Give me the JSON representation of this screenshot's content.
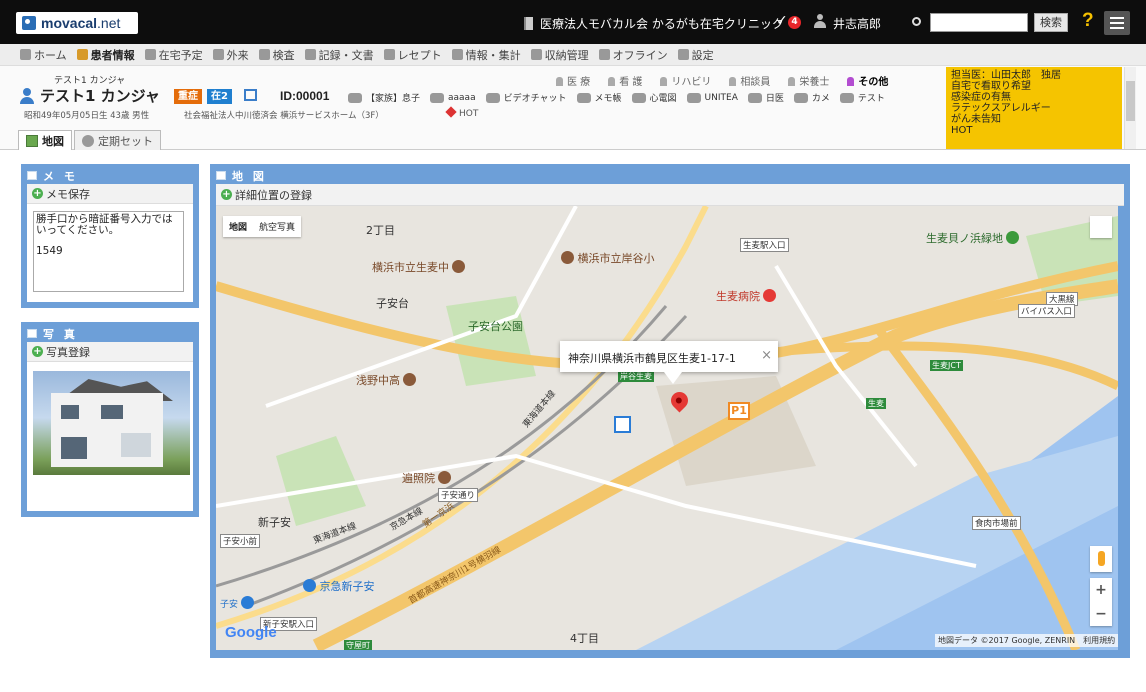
{
  "topbar": {
    "logo_text": "movacal",
    "logo_suffix": ".net",
    "facility": "医療法人モバカル会 かるがも在宅クリニック",
    "notification_count": "4",
    "user_name": "井志高郎",
    "search_placeholder": "",
    "search_button": "検索",
    "help": "?"
  },
  "nav": {
    "items": [
      {
        "label": "ホーム",
        "icon": "home-icon"
      },
      {
        "label": "患者情報",
        "icon": "patient-icon",
        "active": true
      },
      {
        "label": "在宅予定",
        "icon": "clock-icon"
      },
      {
        "label": "外来",
        "icon": "building-icon"
      },
      {
        "label": "検査",
        "icon": "chart-icon"
      },
      {
        "label": "記録・文書",
        "icon": "document-icon"
      },
      {
        "label": "レセプト",
        "icon": "receipt-icon"
      },
      {
        "label": "情報・集計",
        "icon": "database-icon"
      },
      {
        "label": "収納管理",
        "icon": "wallet-icon"
      },
      {
        "label": "オフライン",
        "icon": "offline-icon"
      },
      {
        "label": "設定",
        "icon": "gear-icon"
      }
    ]
  },
  "patient": {
    "kana": "テスト1 カンジャ",
    "name": "テスト1 カンジャ",
    "tag_severity": "重症",
    "tag_home": "在2",
    "id": "ID:00001",
    "birth": "昭和49年05月05日生 43歳 男性",
    "facility": "社会福祉法人中川徳済会 横浜サービスホーム（3F）",
    "hot": "HOT",
    "links": [
      "【家族】息子",
      "aaaaa",
      "ビデオチャット",
      "メモ帳",
      "心電図",
      "UNITEA",
      "日医",
      "カメ",
      "テスト"
    ],
    "roles": [
      {
        "label": "医 療",
        "active": false
      },
      {
        "label": "看 護",
        "active": false
      },
      {
        "label": "リハビリ",
        "active": false
      },
      {
        "label": "相談員",
        "active": false
      },
      {
        "label": "栄養士",
        "active": false
      },
      {
        "label": "その他",
        "active": true
      }
    ],
    "notes": [
      "担当医：山田太郎　独居",
      "自宅で看取り希望",
      "感染症の有無",
      "ラテックスアレルギー",
      "がん未告知",
      "HOT"
    ],
    "tabs": [
      {
        "label": "地図",
        "active": true
      },
      {
        "label": "定期セット",
        "active": false
      }
    ]
  },
  "memo": {
    "title": "メ モ",
    "save_button": "メモ保存",
    "text_line1": "勝手口から暗証番号入力では",
    "text_line2": "いってください。",
    "text_line3": "1549"
  },
  "photo": {
    "title": "写 真",
    "register_button": "写真登録"
  },
  "map": {
    "title": "地 図",
    "register_button": "詳細位置の登録",
    "type_map": "地図",
    "type_satellite": "航空写真",
    "info_address": "神奈川県横浜市鶴見区生麦1-17-1",
    "info_close": "×",
    "labels": {
      "chome2": "2丁目",
      "school1": "横浜市立生麦中",
      "school2": "横浜市立岸谷小",
      "koyasudai": "子安台",
      "park": "子安台公園",
      "hospital": "生麦病院",
      "school3": "浅野中高",
      "temple": "遍照院",
      "shinkoyasu": "新子安",
      "keikyu": "京急新子安",
      "chome4": "4丁目",
      "greenpark": "生麦貝ノ浜緑地",
      "koyasu": "子安",
      "line1": "東海道本線",
      "line2": "京急本線",
      "line3": "第一京浜",
      "line4": "首都高速神奈川1号横羽線",
      "line5": "東海道本線"
    },
    "signs": {
      "s1": "生麦駅入口",
      "s2": "大黒線",
      "s3": "バイパス入口",
      "s4": "子安小前",
      "s5": "子安通り",
      "s6": "新子安駅入口",
      "s7": "食肉市場前",
      "g1": "岸谷生麦",
      "g2": "生麦JCT",
      "g3": "生麦",
      "g4": "守屋町"
    },
    "parking": "P1",
    "google": "Google",
    "copyright": "地図データ ©2017 Google, ZENRIN　利用規約",
    "zoom_in": "+",
    "zoom_out": "−"
  }
}
